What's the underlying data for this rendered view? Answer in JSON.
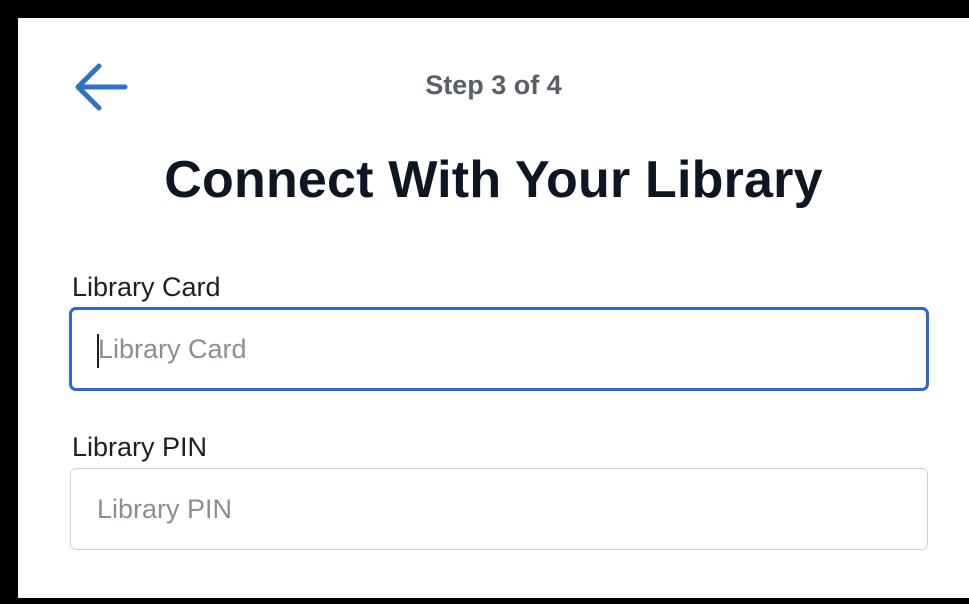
{
  "header": {
    "back_icon": "arrow-left-icon",
    "step_text": "Step 3 of 4",
    "title": "Connect With Your Library"
  },
  "form": {
    "card_label": "Library Card",
    "card_placeholder": "Library Card",
    "card_value": "",
    "pin_label": "Library PIN",
    "pin_placeholder": "Library PIN",
    "pin_value": ""
  },
  "colors": {
    "accent": "#2a66d6",
    "back_arrow": "#2f72c4",
    "title": "#0e1624",
    "step": "#5a5f66"
  }
}
